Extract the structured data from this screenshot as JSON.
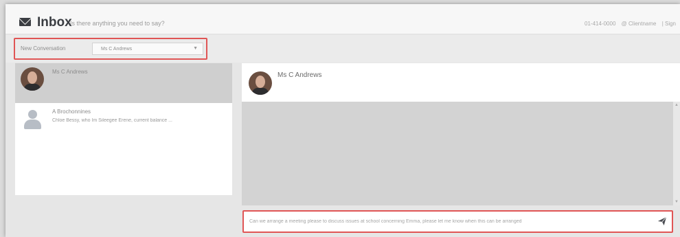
{
  "header": {
    "title": "Inbox",
    "subtitle": "Is there anything you need to say?",
    "right_items": [
      "01-414-0000",
      "@ Clientname",
      "| Sign"
    ]
  },
  "toolbar": {
    "new_conversation_label": "New Conversation",
    "recipient_value": "Ms C Andrews"
  },
  "conversations": [
    {
      "name": "Ms C Andrews",
      "preview": "",
      "avatar": "photo-avatar",
      "active": true
    },
    {
      "name": "A Brochonnines",
      "preview": "Chloe Bessy, who Im Sileegee Erene, current balance ...",
      "avatar": "generic-user-avatar",
      "active": false
    }
  ],
  "chat": {
    "title": "Ms C Andrews"
  },
  "compose": {
    "placeholder": "Can we arrange a meeting please to discuss issues at school concerning Emma, please let me know when this can be arranged",
    "send_icon": "paper-plane-icon"
  },
  "colors": {
    "highlight_border": "#e05555",
    "active_item": "#cfcfcf",
    "message_area": "#d3d3d3",
    "brand_dark": "#3a3d42"
  }
}
